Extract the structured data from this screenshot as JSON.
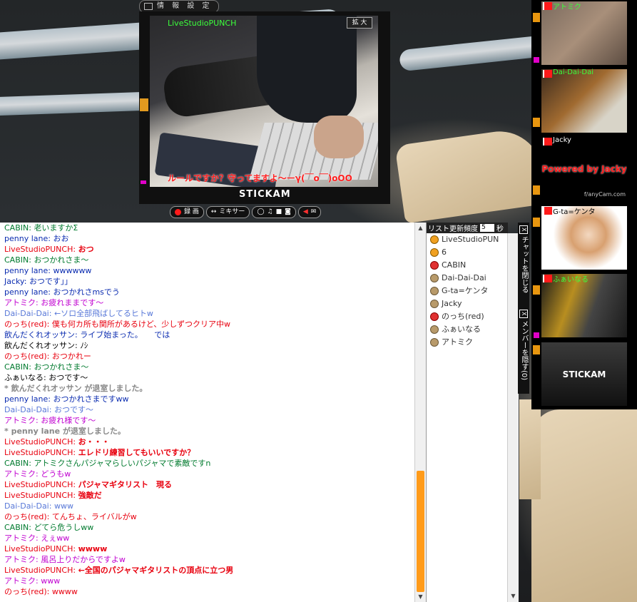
{
  "toolbar": {
    "settings_label": "情 報 設 定"
  },
  "main_video": {
    "broadcaster": "LiveStudioPUNCH",
    "zoom_label": "拡 大",
    "caption": "ルールですか？守ってますよ〜ーγ(￣o￣)oOO"
  },
  "brand": {
    "logo": "STICKAM"
  },
  "controls": {
    "record": "録 画",
    "mixer": "ミキサー"
  },
  "cams": [
    {
      "name": "アトミク"
    },
    {
      "name": "Dai-Dai-Dai"
    },
    {
      "name": "Jacky",
      "banner": "Powered by Jacky",
      "site": "f/anyCam.com"
    },
    {
      "name": "G-ta=ケンタ"
    },
    {
      "name": "ふぁいなる"
    },
    {
      "name": "",
      "logo": "STICKAM"
    }
  ],
  "chat": [
    {
      "user": "CABIN",
      "msg": "老いますかΣ",
      "color": "green"
    },
    {
      "user": "penny lane",
      "msg": "おお",
      "color": "blue"
    },
    {
      "user": "LiveStudioPUNCH",
      "msg": "おつ",
      "color": "red",
      "bold": true
    },
    {
      "user": "CABIN",
      "msg": "おつかれさま〜",
      "color": "green"
    },
    {
      "user": "penny lane",
      "msg": "wwwwww",
      "color": "blue"
    },
    {
      "user": "Jacky",
      "msg": "おつです」」",
      "color": "blue"
    },
    {
      "user": "penny lane",
      "msg": "おつかれさmsでう",
      "color": "blue"
    },
    {
      "user": "アトミク",
      "msg": "お疲れままです〜",
      "color": "mag"
    },
    {
      "user": "Dai-Dai-Dai",
      "msg": "←ソロ全部飛ばしてるヒトw",
      "color": "lblue"
    },
    {
      "user": "のっち(red)",
      "msg": "僕も何カ所も関所があるけど、少しずつクリア中w",
      "color": "red"
    },
    {
      "user": "飲んだくれオッサン",
      "msg": "ライブ始まった。　　では",
      "color": "blue"
    },
    {
      "user": "飲んだくれオッサン",
      "msg": "ﾉｼ",
      "color": "black"
    },
    {
      "user": "のっち(red)",
      "msg": "おつかれー",
      "color": "red"
    },
    {
      "user": "CABIN",
      "msg": "おつかれさま〜",
      "color": "green"
    },
    {
      "user": "ふぁいなる",
      "msg": "おつです〜",
      "color": "black"
    },
    {
      "system": "* 飲んだくれオッサン が退室しました。"
    },
    {
      "user": "penny lane",
      "msg": "おつかれさまですww",
      "color": "blue"
    },
    {
      "user": "Dai-Dai-Dai",
      "msg": "おつです〜",
      "color": "lblue"
    },
    {
      "user": "アトミク",
      "msg": "お疲れ様です〜",
      "color": "mag"
    },
    {
      "system": "* penny lane が退室しました。"
    },
    {
      "user": "LiveStudioPUNCH",
      "msg": "お・・・",
      "color": "red",
      "bold": true
    },
    {
      "user": "LiveStudioPUNCH",
      "msg": "エレドリ練習してもいいですか？",
      "color": "red",
      "bold": true
    },
    {
      "user": "CABIN",
      "msg": "アトミクさんパジャマらしいパジャマで素敵ですn",
      "color": "green"
    },
    {
      "user": "アトミク",
      "msg": "どうもw",
      "color": "mag"
    },
    {
      "user": "LiveStudioPUNCH",
      "msg": "パジャマギタリスト　現る",
      "color": "red",
      "bold": true
    },
    {
      "user": "LiveStudioPUNCH",
      "msg": "強敵だ",
      "color": "red",
      "bold": true
    },
    {
      "user": "Dai-Dai-Dai",
      "msg": "www",
      "color": "lblue"
    },
    {
      "user": "のっち(red)",
      "msg": "てんちょ、ライバルがw",
      "color": "red"
    },
    {
      "user": "CABIN",
      "msg": "どてら危うしww",
      "color": "green"
    },
    {
      "user": "アトミク",
      "msg": "えぇww",
      "color": "mag"
    },
    {
      "user": "LiveStudioPUNCH",
      "msg": "wwww",
      "color": "red",
      "bold": true
    },
    {
      "user": "アトミク",
      "msg": "風呂上りだからですよw",
      "color": "mag"
    },
    {
      "user": "LiveStudioPUNCH",
      "msg": "←全国のパジャマギタリストの頂点に立つ男",
      "color": "red",
      "bold": true
    },
    {
      "user": "アトミク",
      "msg": "www",
      "color": "mag"
    },
    {
      "user": "のっち(red)",
      "msg": "wwww",
      "color": "red"
    }
  ],
  "userlist": {
    "header": "リスト更新頻度",
    "interval": "5",
    "unit": "秒",
    "users": [
      {
        "name": "LiveStudioPUN",
        "av": "o"
      },
      {
        "name": "6",
        "av": "o"
      },
      {
        "name": "CABIN",
        "av": "r"
      },
      {
        "name": "Dai-Dai-Dai",
        "av": ""
      },
      {
        "name": "G-ta=ケンタ",
        "av": ""
      },
      {
        "name": "Jacky",
        "av": ""
      },
      {
        "name": "のっち(red)",
        "av": "r"
      },
      {
        "name": "ふぁいなる",
        "av": ""
      },
      {
        "name": "アトミク",
        "av": ""
      }
    ]
  },
  "side_tabs": {
    "close_chat": "チャットを閉じる",
    "hide_members": "メンバーを隠す",
    "close_mark": "X",
    "count": "(0)"
  },
  "colors": {
    "green": "#007a2e",
    "blue": "#0b2cb0",
    "red": "#e8000e",
    "mag": "#c000d0",
    "lblue": "#5878d8",
    "black": "#000000"
  }
}
